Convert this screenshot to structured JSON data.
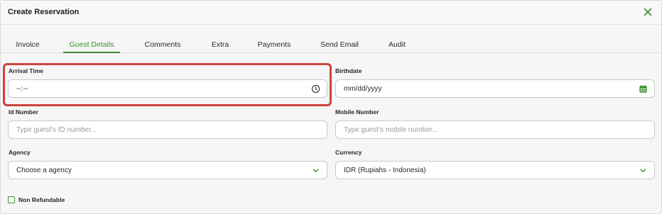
{
  "modal": {
    "title": "Create Reservation",
    "close_icon": "close-x-icon"
  },
  "tabs": [
    {
      "label": "Invoice",
      "active": false
    },
    {
      "label": "Guest Details",
      "active": true
    },
    {
      "label": "Comments",
      "active": false
    },
    {
      "label": "Extra",
      "active": false
    },
    {
      "label": "Payments",
      "active": false
    },
    {
      "label": "Send Email",
      "active": false
    },
    {
      "label": "Audit",
      "active": false
    }
  ],
  "form": {
    "arrival_time": {
      "label": "Arrival Time",
      "value": "--:--",
      "icon": "clock-icon"
    },
    "birthdate": {
      "label": "Birthdate",
      "value": "mm/dd/yyyy",
      "icon": "calendar-icon"
    },
    "id_number": {
      "label": "Id Number",
      "placeholder": "Type guest's ID number..."
    },
    "mobile_number": {
      "label": "Mobile Number",
      "placeholder": "Type guest's mobile number..."
    },
    "agency": {
      "label": "Agency",
      "value": "Choose a agency",
      "icon": "chevron-down-icon"
    },
    "currency": {
      "label": "Currency",
      "value": "IDR (Rupiahs - Indonesia)",
      "icon": "chevron-down-icon"
    },
    "non_refundable": {
      "label": "Non Refundable",
      "checked": false
    }
  },
  "colors": {
    "accent": "#3a8f2c",
    "highlight": "#c9443c"
  }
}
